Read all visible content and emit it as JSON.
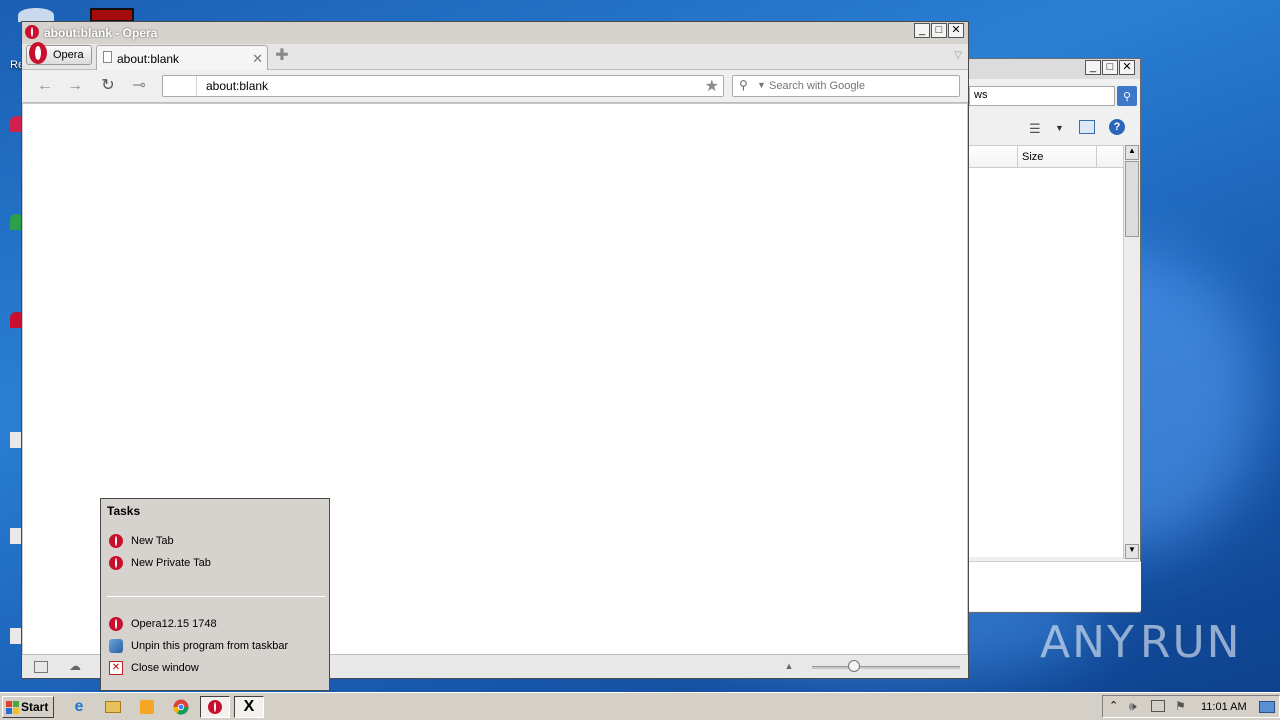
{
  "opera": {
    "window_title": "about:blank - Opera",
    "menu_label": "Opera",
    "tab_title": "about:blank",
    "address_value": "about:blank",
    "search_placeholder": "Search with Google"
  },
  "explorer": {
    "search_value": "ws",
    "column_size": "Size"
  },
  "jumplist": {
    "heading": "Tasks",
    "tasks": [
      {
        "label": "New Tab",
        "icon": "opera-icon"
      },
      {
        "label": "New Private Tab",
        "icon": "opera-icon"
      }
    ],
    "pinned": [
      {
        "label": "Opera12.15 1748",
        "icon": "opera-icon"
      },
      {
        "label": "Unpin this program from taskbar",
        "icon": "unpin-icon"
      },
      {
        "label": "Close window",
        "icon": "close-window-icon"
      }
    ]
  },
  "taskbar": {
    "start_label": "Start",
    "clock": "11:01 AM"
  },
  "watermark": {
    "text_left": "ANY",
    "text_right": "RUN"
  },
  "desktop": {
    "icon_label_partial": "Re"
  },
  "colors": {
    "opera_red": "#c8102e",
    "desktop_blue": "#1a5fb4",
    "window_gray": "#d6d3ce"
  }
}
